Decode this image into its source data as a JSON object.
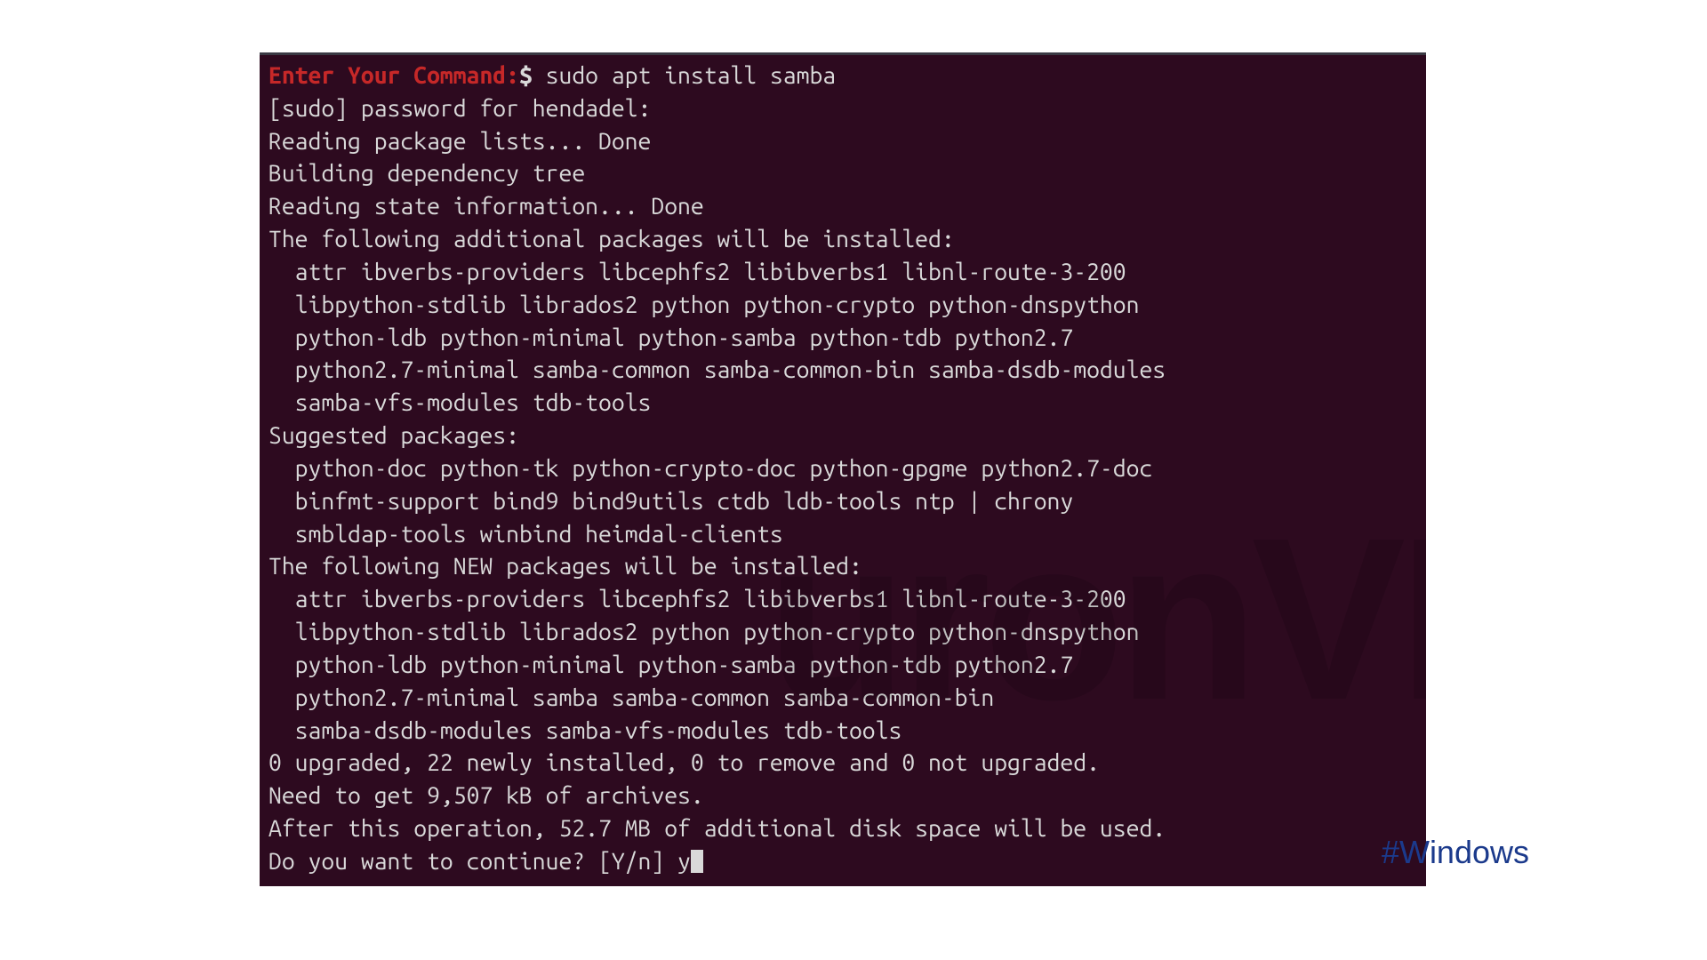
{
  "terminal": {
    "prompt": "Enter Your Command:",
    "dollar": "$",
    "command": " sudo apt install samba",
    "sudo_pw": "[sudo] password for hendadel:",
    "l1": "Reading package lists... Done",
    "l2": "Building dependency tree",
    "l3": "Reading state information... Done",
    "addl_header": "The following additional packages will be installed:",
    "addl_1": "  attr ibverbs-providers libcephfs2 libibverbs1 libnl-route-3-200",
    "addl_2": "  libpython-stdlib librados2 python python-crypto python-dnspython",
    "addl_3": "  python-ldb python-minimal python-samba python-tdb python2.7",
    "addl_4": "  python2.7-minimal samba-common samba-common-bin samba-dsdb-modules",
    "addl_5": "  samba-vfs-modules tdb-tools",
    "sugg_header": "Suggested packages:",
    "sugg_1": "  python-doc python-tk python-crypto-doc python-gpgme python2.7-doc",
    "sugg_2": "  binfmt-support bind9 bind9utils ctdb ldb-tools ntp | chrony",
    "sugg_3": "  smbldap-tools winbind heimdal-clients",
    "new_header": "The following NEW packages will be installed:",
    "new_1": "  attr ibverbs-providers libcephfs2 libibverbs1 libnl-route-3-200",
    "new_2": "  libpython-stdlib librados2 python python-crypto python-dnspython",
    "new_3": "  python-ldb python-minimal python-samba python-tdb python2.7",
    "new_4": "  python2.7-minimal samba samba-common samba-common-bin",
    "new_5": "  samba-dsdb-modules samba-vfs-modules tdb-tools",
    "summary1": "0 upgraded, 22 newly installed, 0 to remove and 0 not upgraded.",
    "summary2": "Need to get 9,507 kB of archives.",
    "summary3": "After this operation, 52.7 MB of additional disk space will be used.",
    "confirm_prompt": "Do you want to continue? [Y/n] ",
    "confirm_input": "y"
  },
  "watermark": "uronVM",
  "hashtag": "#Windows"
}
